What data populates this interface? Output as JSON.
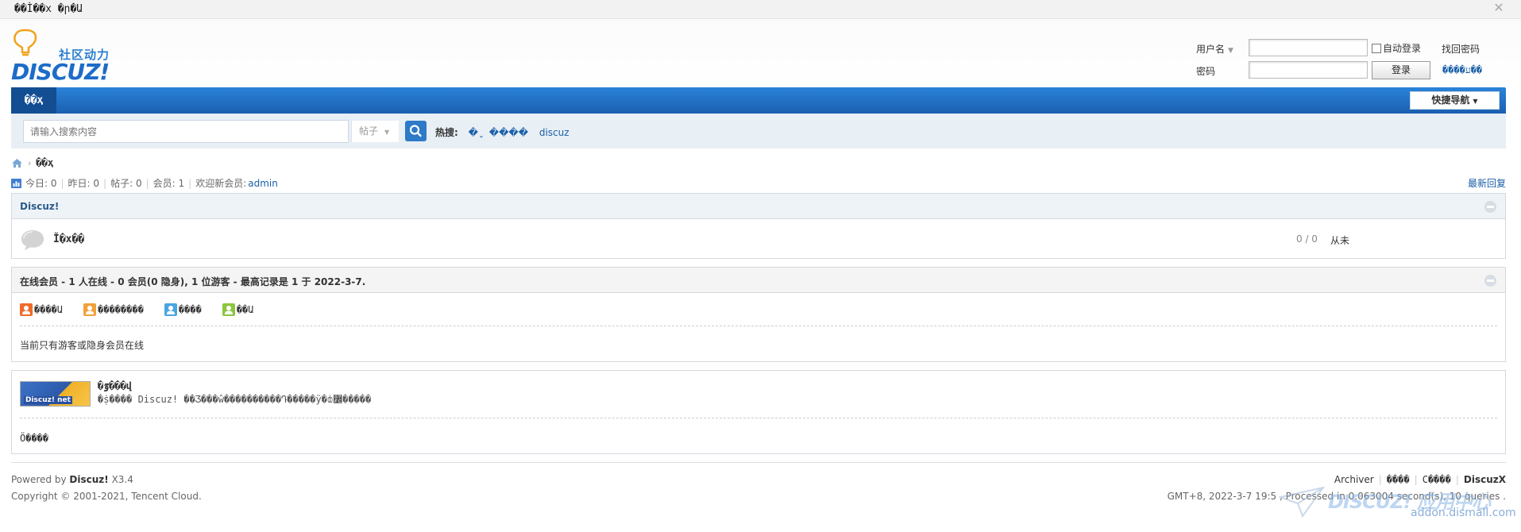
{
  "window": {
    "title": "��Ì��x �ր�Ա"
  },
  "logo": {
    "slogan": "社区动力",
    "wordmark": "DISCUZ!"
  },
  "login": {
    "username_label": "用户名",
    "password_label": "密码",
    "username_value": "",
    "password_value": "",
    "auto_login_label": "自动登录",
    "auto_login_checked": false,
    "forgot_password": "找回密码",
    "submit": "登录",
    "register": "����ע��"
  },
  "nav": {
    "active_tab": "��ҳ",
    "quick_nav": "快捷导航"
  },
  "search": {
    "placeholder": "请输入搜索内容",
    "scope": "帖子",
    "hot_label": "热搜:",
    "hot_items": [
      "�ָ",
      "����",
      "discuz"
    ]
  },
  "breadcrumb": {
    "current": "��ҳ"
  },
  "stats": {
    "today": "今日: 0",
    "yesterday": "昨日: 0",
    "posts": "帖子: 0",
    "members": "会员: 1",
    "welcome": "欢迎新会员:",
    "newest_member": "admin",
    "latest_replies": "最新回复"
  },
  "category": {
    "name": "Discuz!",
    "forum": {
      "name": "Ĭ�x��",
      "counts": "0 / 0",
      "last_post": "从未"
    }
  },
  "online": {
    "title": "在线会员 - 1 人在线 - 0 会员(0 隐身), 1 位游客 - 最高记录是 1 于 2022-3-7.",
    "legend": [
      "����Ա",
      "��������",
      "����",
      "��Ա"
    ],
    "legend_colors": [
      "#f06b2a",
      "#f2a13c",
      "#4aa6e0",
      "#8cc63f"
    ],
    "note": "当前只有游客或隐身会员在线"
  },
  "links": {
    "banner_text": "Discuz! net",
    "title": "�ٷ���վ",
    "description": "�ṩ���� Discuz! ��Ʒ���ŵ����������Դ�����ÿ�ȸ߼�����",
    "footer": "Ö����"
  },
  "footer": {
    "powered_prefix": "Powered by",
    "powered_brand": "Discuz!",
    "powered_version": "X3.4",
    "copyright": "Copyright © 2001-2021, Tencent Cloud.",
    "links": [
      "Archiver",
      "����",
      "C����"
    ],
    "brand_right": "DiscuzX",
    "timing": "GMT+8, 2022-3-7 19:5 , Processed in 0.063004 second(s), 10 queries ."
  },
  "watermark": {
    "brand": "DISCUZ! 应用中心",
    "url": "addon.dismall.com"
  },
  "colors": {
    "nav_blue": "#1b5fb0",
    "link_blue": "#1a5fa8",
    "search_bg": "#e8eff5"
  }
}
